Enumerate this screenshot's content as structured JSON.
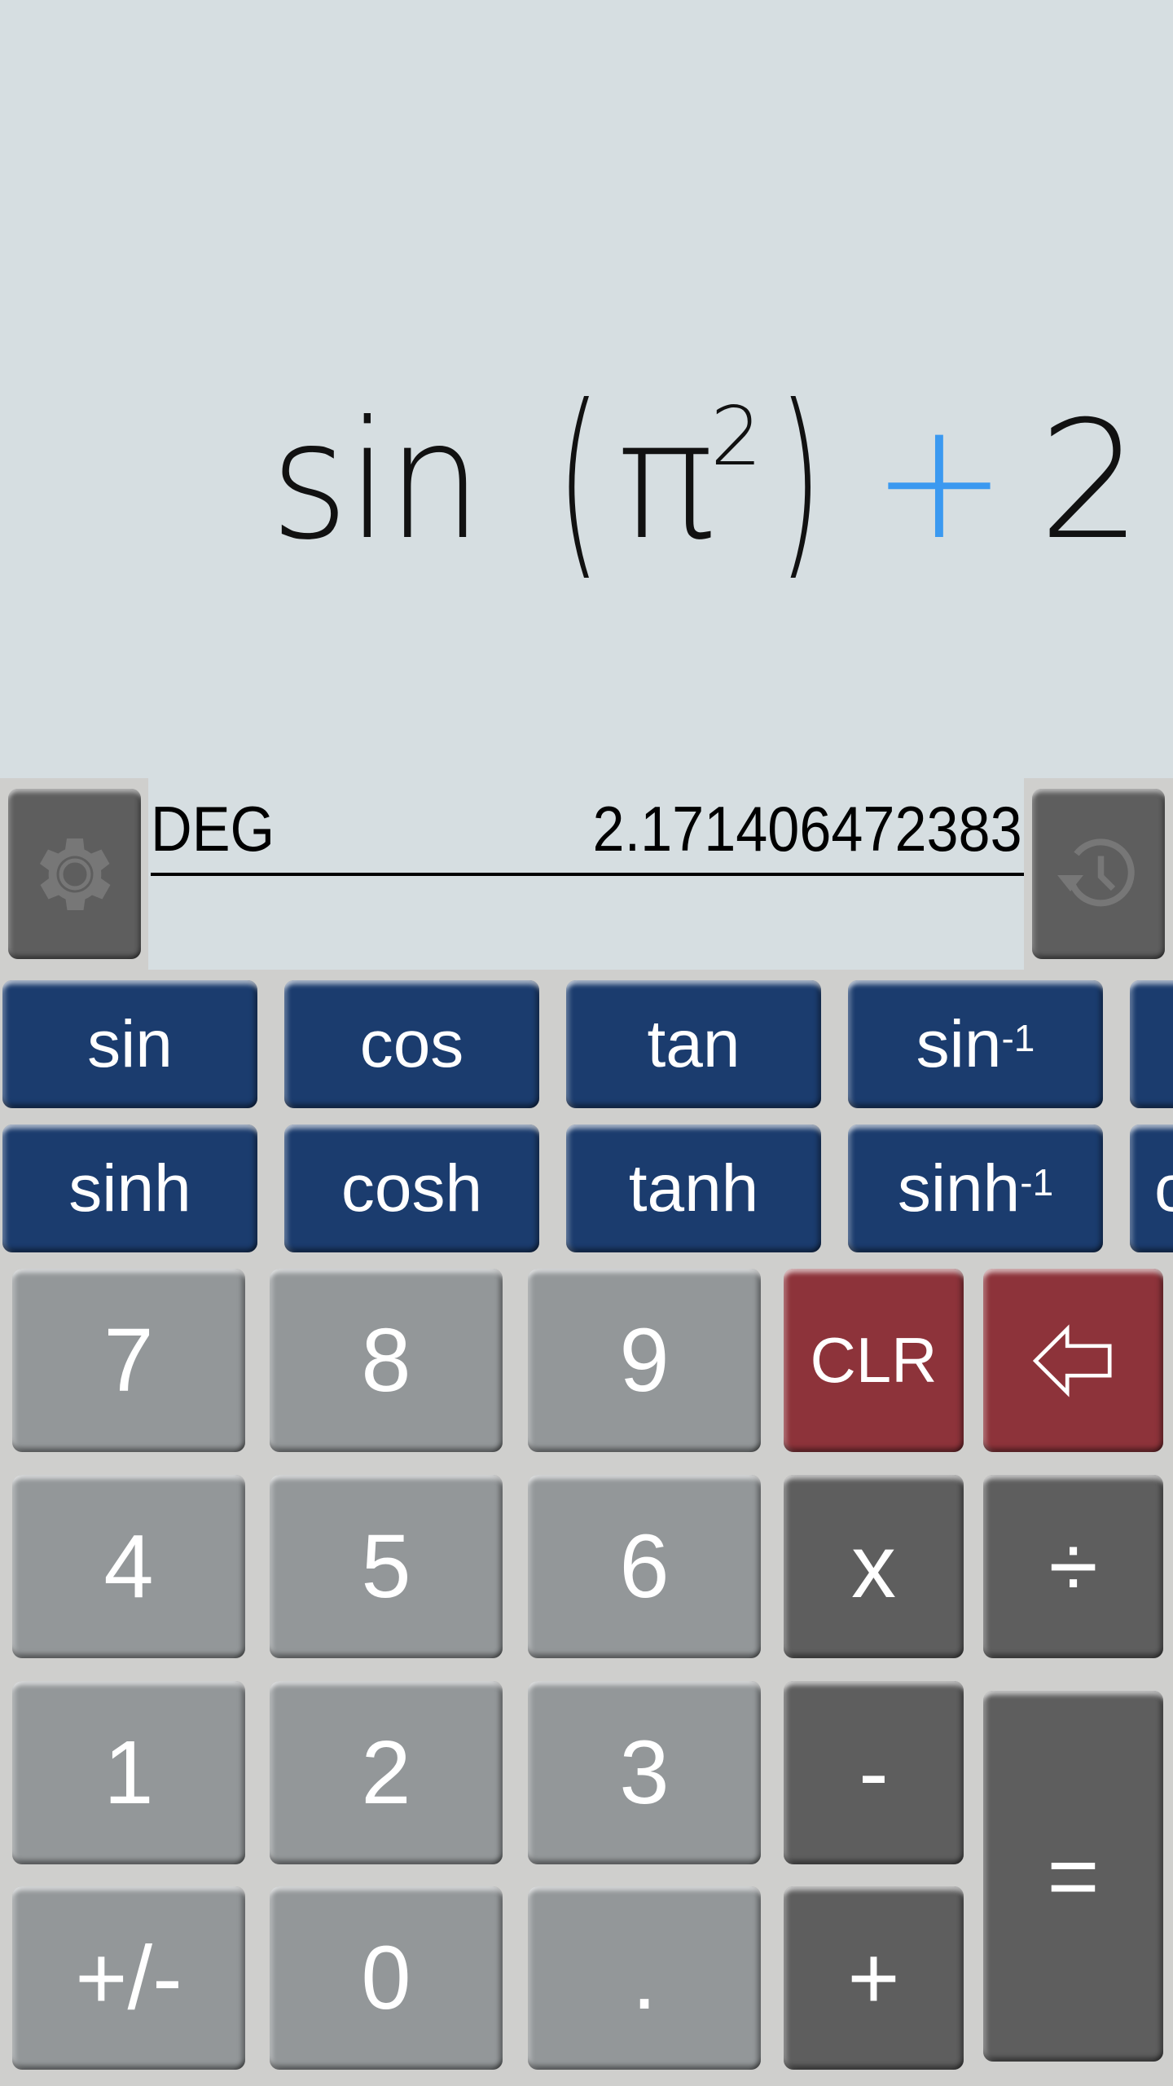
{
  "display": {
    "expression": {
      "function": "sin",
      "open_paren": "(",
      "base": "π",
      "exponent": "2",
      "close_paren": ")",
      "operator": "+",
      "operand": "2"
    },
    "angle_mode": "DEG",
    "result": "2.171406472383"
  },
  "side_buttons": {
    "settings_icon": "gear-icon",
    "history_icon": "history-icon"
  },
  "function_rows": [
    [
      {
        "label": "sin",
        "sup": ""
      },
      {
        "label": "cos",
        "sup": ""
      },
      {
        "label": "tan",
        "sup": ""
      },
      {
        "label": "sin",
        "sup": "-1"
      },
      {
        "label": "",
        "sup": ""
      }
    ],
    [
      {
        "label": "sinh",
        "sup": ""
      },
      {
        "label": "cosh",
        "sup": ""
      },
      {
        "label": "tanh",
        "sup": ""
      },
      {
        "label": "sinh",
        "sup": "-1"
      },
      {
        "label": "c",
        "sup": ""
      }
    ]
  ],
  "keypad": {
    "row1": [
      "7",
      "8",
      "9",
      "CLR",
      "backspace"
    ],
    "row2": [
      "4",
      "5",
      "6",
      "x",
      "÷"
    ],
    "row3": [
      "1",
      "2",
      "3",
      "-"
    ],
    "row4": [
      "+/-",
      "0",
      ".",
      "+"
    ],
    "equals": "="
  },
  "colors": {
    "display_bg": "#d6dee1",
    "keypad_bg": "#cfcfcd",
    "function_key": "#1b3c6e",
    "digit_key": "#939799",
    "operator_key": "#5e5e5e",
    "clear_key": "#8d333a",
    "operator_highlight": "#3b99f0"
  }
}
